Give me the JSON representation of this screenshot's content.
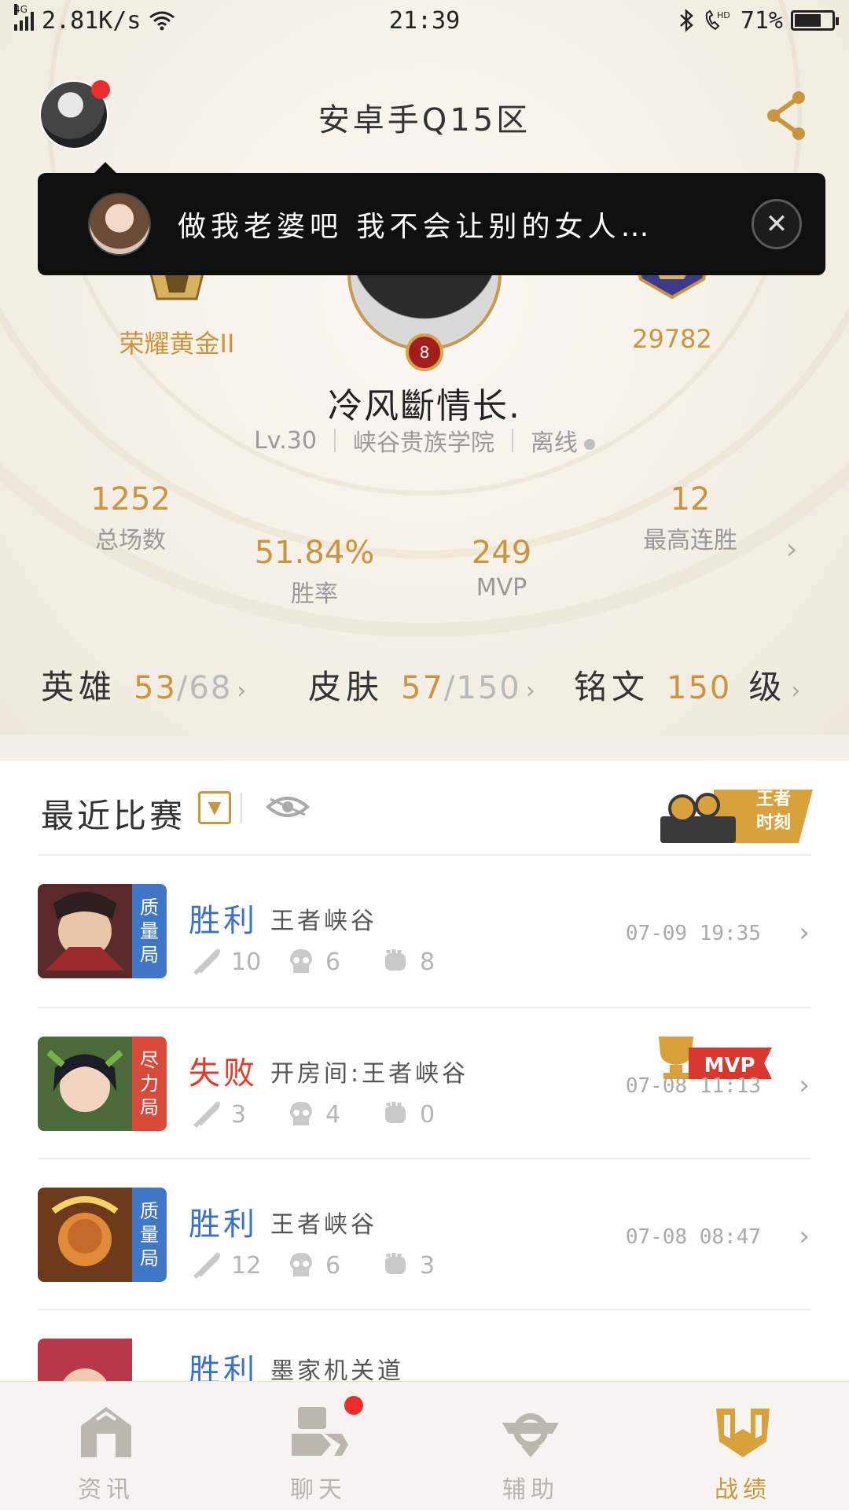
{
  "status_bar": {
    "network": "4G",
    "speed": "2.81K/s",
    "time": "21:39",
    "battery_text": "71%",
    "battery_level": 0.71
  },
  "header": {
    "zone_title": "安卓手Q15区"
  },
  "toast": {
    "message": "做我老婆吧 我不会让别的女人…"
  },
  "profile": {
    "rank_label": "荣耀黄金II",
    "score": "29782",
    "level_badge": "8",
    "name": "冷风斷情长.",
    "level": "Lv.30",
    "school": "峡谷贵族学院",
    "status": "离线"
  },
  "stats": [
    {
      "value": "1252",
      "label": "总场数"
    },
    {
      "value": "51.84%",
      "label": "胜率"
    },
    {
      "value": "249",
      "label": "MVP"
    },
    {
      "value": "12",
      "label": "最高连胜"
    }
  ],
  "collection": {
    "hero_label": "英雄",
    "hero_owned": "53",
    "hero_total": "/68",
    "skin_label": "皮肤",
    "skin_owned": "57",
    "skin_total": "/150",
    "rune_label": "铭文",
    "rune_level": "150",
    "rune_suffix": "级"
  },
  "recent": {
    "title": "最近比赛",
    "king_moment_line1": "王者",
    "king_moment_line2": "时刻"
  },
  "matches": [
    {
      "tag": "质量局",
      "tag_color": "#3f76c6",
      "result": "胜利",
      "mode": "王者峡谷",
      "kills": "10",
      "deaths": "6",
      "assists": "8",
      "time": "07-09 19:35"
    },
    {
      "tag": "尽力局",
      "tag_color": "#d84a3a",
      "result": "失败",
      "mode": "开房间:王者峡谷",
      "kills": "3",
      "deaths": "4",
      "assists": "0",
      "time": "07-08 11:13",
      "mvp": "MVP"
    },
    {
      "tag": "质量局",
      "tag_color": "#3f76c6",
      "result": "胜利",
      "mode": "王者峡谷",
      "kills": "12",
      "deaths": "6",
      "assists": "3",
      "time": "07-08 08:47"
    },
    {
      "result": "胜利",
      "mode": "墨家机关道"
    }
  ],
  "nav": [
    {
      "label": "资讯",
      "icon": "news-icon"
    },
    {
      "label": "聊天",
      "icon": "chat-icon"
    },
    {
      "label": "辅助",
      "icon": "assist-icon"
    },
    {
      "label": "战绩",
      "icon": "record-icon"
    }
  ],
  "colors": {
    "gold": "#c8963e",
    "win_blue": "#3b71c4",
    "loss_red": "#e03a2c"
  }
}
